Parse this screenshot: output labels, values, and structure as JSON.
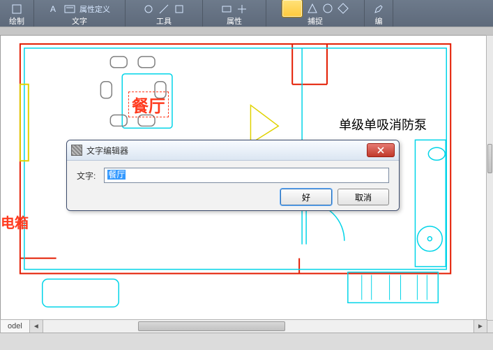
{
  "ribbon": {
    "groups": [
      {
        "label": "绘制"
      },
      {
        "label": "文字",
        "detail": "属性定义"
      },
      {
        "label": "工具"
      },
      {
        "label": "属性"
      },
      {
        "label": "捕捉"
      },
      {
        "label": "编"
      }
    ]
  },
  "canvas": {
    "annot_dining": "餐厅",
    "annot_pump": "单级单吸消防泵",
    "annot_box": "电箱"
  },
  "dialog": {
    "title": "文字编辑器",
    "field_label": "文字:",
    "field_value": "餐厅",
    "ok": "好",
    "cancel": "取消"
  },
  "tabs": {
    "model": "odel"
  }
}
